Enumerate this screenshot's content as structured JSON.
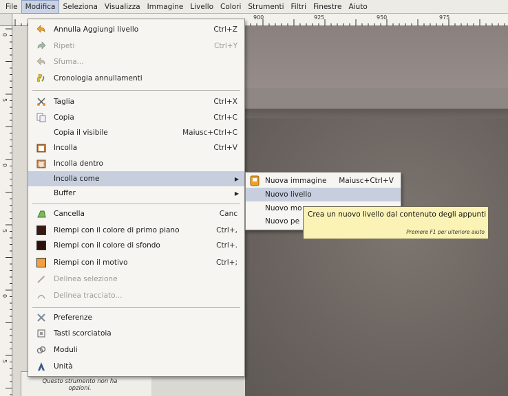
{
  "menubar": {
    "items": [
      "File",
      "Modifica",
      "Seleziona",
      "Visualizza",
      "Immagine",
      "Livello",
      "Colori",
      "Strumenti",
      "Filtri",
      "Finestre",
      "Aiuto"
    ],
    "active": "Modifica"
  },
  "ruler": {
    "h_labels": [
      "900",
      "925",
      "950",
      "975"
    ],
    "v_labels": [
      "0",
      "5",
      "0",
      "5",
      "0",
      "5",
      "0",
      "5"
    ]
  },
  "toolbox": {
    "note": "Questo strumento non ha opzioni."
  },
  "edit_menu": {
    "items": [
      {
        "label": "Annulla Aggiungi livello",
        "shortcut": "Ctrl+Z",
        "icon": "undo-icon",
        "disabled": false
      },
      {
        "label": "Ripeti",
        "shortcut": "Ctrl+Y",
        "icon": "redo-icon",
        "disabled": true
      },
      {
        "label": "Sfuma...",
        "shortcut": "",
        "icon": "fade-icon",
        "disabled": true
      },
      {
        "label": "Cronologia annullamenti",
        "shortcut": "",
        "icon": "history-icon",
        "disabled": false
      },
      {
        "label": "Taglia",
        "shortcut": "Ctrl+X",
        "icon": "scissors-icon",
        "disabled": false
      },
      {
        "label": "Copia",
        "shortcut": "Ctrl+C",
        "icon": "copy-icon",
        "disabled": false
      },
      {
        "label": "Copia il visibile",
        "shortcut": "Maiusc+Ctrl+C",
        "icon": "",
        "disabled": false
      },
      {
        "label": "Incolla",
        "shortcut": "Ctrl+V",
        "icon": "paste-icon",
        "disabled": false
      },
      {
        "label": "Incolla dentro",
        "shortcut": "",
        "icon": "paste-into-icon",
        "disabled": false
      },
      {
        "label": "Incolla come",
        "shortcut": "",
        "icon": "",
        "disabled": false
      },
      {
        "label": "Buffer",
        "shortcut": "",
        "icon": "",
        "disabled": false
      },
      {
        "label": "Cancella",
        "shortcut": "Canc",
        "icon": "clear-icon",
        "disabled": false
      },
      {
        "label": "Riempi con il colore di primo piano",
        "shortcut": "Ctrl+,",
        "icon": "fg-fill-icon",
        "disabled": false
      },
      {
        "label": "Riempi con il colore di sfondo",
        "shortcut": "Ctrl+.",
        "icon": "bg-fill-icon",
        "disabled": false
      },
      {
        "label": "Riempi con il motivo",
        "shortcut": "Ctrl+;",
        "icon": "pattern-fill-icon",
        "disabled": false
      },
      {
        "label": "Delinea selezione",
        "shortcut": "",
        "icon": "stroke-selection-icon",
        "disabled": true
      },
      {
        "label": "Delinea tracciato...",
        "shortcut": "",
        "icon": "stroke-path-icon",
        "disabled": true
      },
      {
        "label": "Preferenze",
        "shortcut": "",
        "icon": "preferences-icon",
        "disabled": false
      },
      {
        "label": "Tasti scorciatoia",
        "shortcut": "",
        "icon": "keyboard-icon",
        "disabled": false
      },
      {
        "label": "Moduli",
        "shortcut": "",
        "icon": "modules-icon",
        "disabled": false
      },
      {
        "label": "Unità",
        "shortcut": "",
        "icon": "units-icon",
        "disabled": false
      }
    ],
    "highlighted": "Incolla come"
  },
  "paste_as_submenu": {
    "items": [
      {
        "label": "Nuova immagine",
        "shortcut": "Maiusc+Ctrl+V",
        "icon": "new-image-icon"
      },
      {
        "label": "Nuovo livello",
        "shortcut": ""
      },
      {
        "label": "Nuovo mo",
        "shortcut": ""
      },
      {
        "label": "Nuovo pe",
        "shortcut": ""
      }
    ],
    "highlighted": "Nuovo livello"
  },
  "tooltip": {
    "text": "Crea un nuovo livello dal contenuto degli appunti",
    "hint": "Premere F1 per ulteriore aiuto"
  },
  "colors": {
    "menu_bg": "#f6f5f2",
    "highlight": "#c7cfdf",
    "tooltip_bg": "#fbf3b5",
    "canvas": "#8f8784",
    "fg_swatch": "#3a1a10",
    "bg_swatch": "#2a1208",
    "pattern_swatch": "#f0a040"
  }
}
